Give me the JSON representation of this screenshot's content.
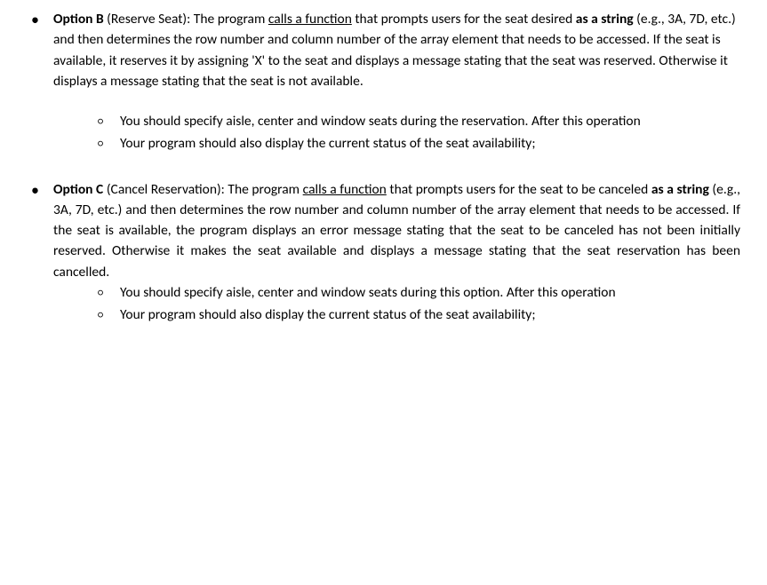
{
  "item_b": {
    "label": "Option B",
    "paren": " (Reserve Seat): The program ",
    "calls": "calls a function",
    "after_calls": " that prompts users for the seat desired ",
    "as_string": "as a string",
    "rest": " (e.g., 3A, 7D, etc.) and then determines the row number and column number of the array element that needs to be accessed. If the seat is available, it reserves it by assigning 'X' to the seat and displays a message stating that the seat was reserved. Otherwise it displays a message stating that the seat is not available.",
    "sub1": "You should specify aisle, center and window seats during the reservation. After this operation",
    "sub2": "Your program should also display the current status of the seat availability;"
  },
  "item_c": {
    "label": "Option C",
    "paren": " (Cancel Reservation): The program ",
    "calls": "calls a function",
    "after_calls": " that prompts users for the seat to be canceled ",
    "as_string": "as a string",
    "rest": " (e.g., 3A, 7D, etc.) and then determines the row number and column number of the array element that needs to be accessed. If the seat is available, the program displays an error message stating that the seat to be canceled has not been initially reserved. Otherwise it makes the seat available and displays a message stating that the seat reservation has been cancelled.",
    "sub1": "You should specify aisle, center and window seats during this option. After this operation",
    "sub2": "Your program should also display the current status of the seat availability;"
  }
}
